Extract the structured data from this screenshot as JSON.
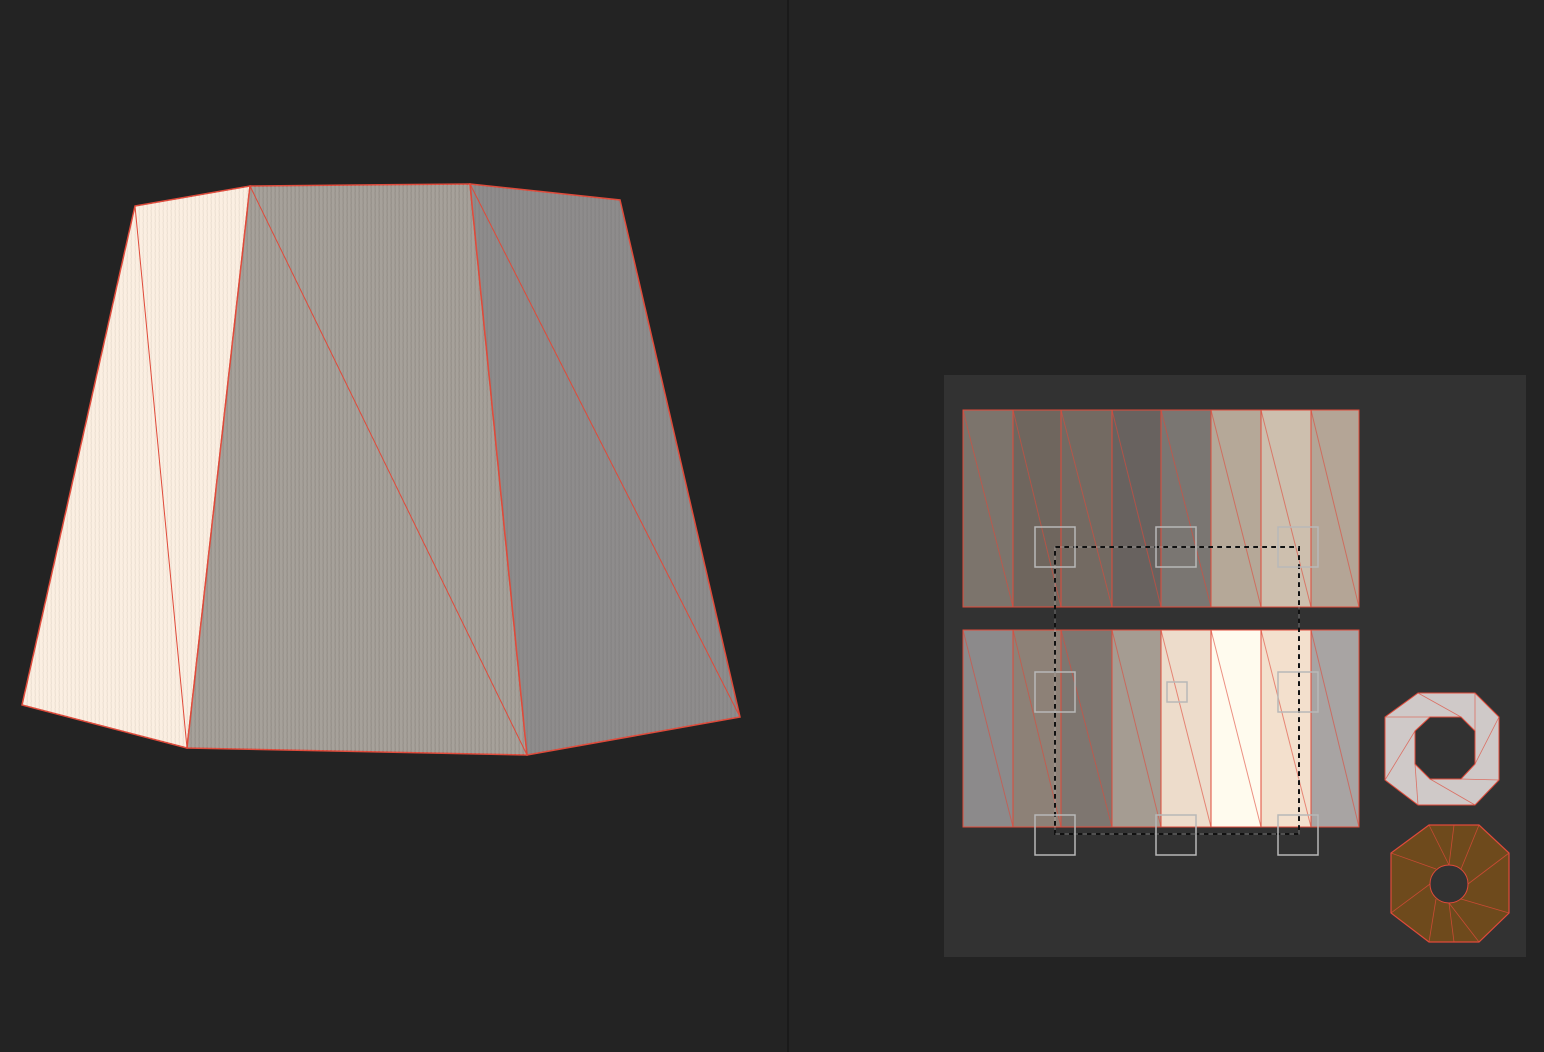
{
  "workspace": {
    "views": [
      "3d-viewport",
      "uv-editor"
    ]
  },
  "colors": {
    "background": "#232323",
    "uv_panel": "#323232",
    "edge": "#e04a3a",
    "face_light": "#fbeee0",
    "face_mid": "#9f9a93",
    "face_dark": "#8a8888",
    "selected_faces": "#6e4a1c",
    "selection_box": "#111111",
    "handle": "#b8b8b8"
  },
  "uv_islands": {
    "top_strip_columns": 8,
    "bottom_strip_columns": 8,
    "caps": [
      "top-cap-ring",
      "bottom-cap-ring-selected"
    ]
  },
  "transform_handles": 8
}
